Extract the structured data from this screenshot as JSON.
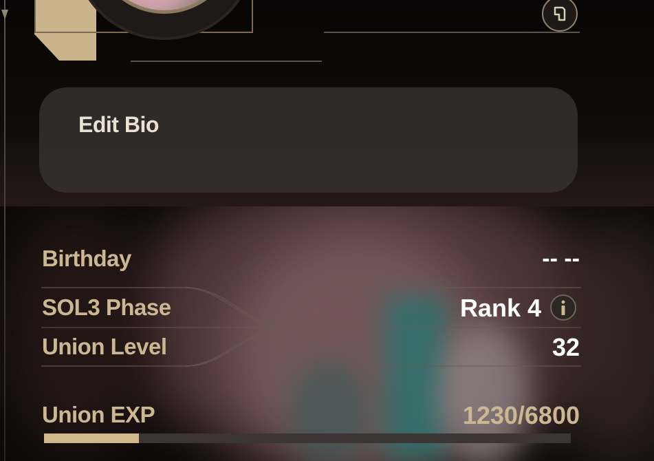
{
  "bio": {
    "title": "Edit Bio"
  },
  "rows": {
    "birthday": {
      "label": "Birthday",
      "value": "-- --"
    },
    "sol3": {
      "label": "SOL3 Phase",
      "value": "Rank 4"
    },
    "union_level": {
      "label": "Union Level",
      "value": "32"
    },
    "union_exp": {
      "label": "Union EXP",
      "value": "1230/6800",
      "progress": 0.18
    }
  },
  "icons": {
    "copy": "copy-icon",
    "info": "info-icon"
  },
  "colors": {
    "accent": "#cfb88c",
    "label": "#ccb793",
    "value": "#ffffff",
    "card": "#373230"
  }
}
